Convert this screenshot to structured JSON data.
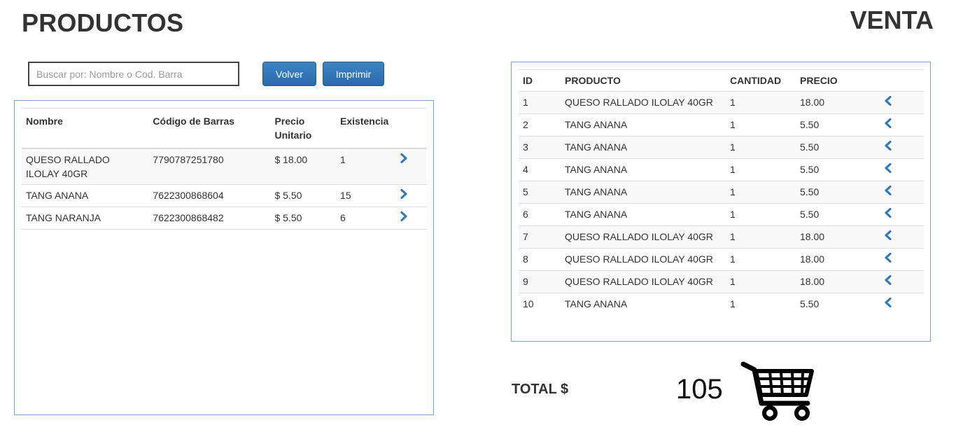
{
  "productos": {
    "title": "PRODUCTOS",
    "search": {
      "placeholder": "Buscar por: Nombre o Cod. Barra",
      "value": ""
    },
    "buttons": {
      "volver": "Volver",
      "imprimir": "Imprimir"
    },
    "columns": [
      "Nombre",
      "Código de Barras",
      "Precio Unitario",
      "Existencia"
    ],
    "rows": [
      {
        "nombre": "QUESO RALLADO ILOLAY 40GR",
        "codigo": "7790787251780",
        "precio": "$ 18.00",
        "existencia": "1"
      },
      {
        "nombre": "TANG ANANA",
        "codigo": "7622300868604",
        "precio": "$ 5.50",
        "existencia": "15"
      },
      {
        "nombre": "TANG NARANJA",
        "codigo": "7622300868482",
        "precio": "$ 5.50",
        "existencia": "6"
      }
    ],
    "row_action_icon": "chevron-right-icon"
  },
  "venta": {
    "title": "VENTA",
    "columns": [
      "ID",
      "PRODUCTO",
      "CANTIDAD",
      "PRECIO"
    ],
    "rows": [
      {
        "id": "1",
        "producto": "QUESO RALLADO ILOLAY 40GR",
        "cantidad": "1",
        "precio": "18.00"
      },
      {
        "id": "2",
        "producto": "TANG ANANA",
        "cantidad": "1",
        "precio": "5.50"
      },
      {
        "id": "3",
        "producto": "TANG ANANA",
        "cantidad": "1",
        "precio": "5.50"
      },
      {
        "id": "4",
        "producto": "TANG ANANA",
        "cantidad": "1",
        "precio": "5.50"
      },
      {
        "id": "5",
        "producto": "TANG ANANA",
        "cantidad": "1",
        "precio": "5.50"
      },
      {
        "id": "6",
        "producto": "TANG ANANA",
        "cantidad": "1",
        "precio": "5.50"
      },
      {
        "id": "7",
        "producto": "QUESO RALLADO ILOLAY 40GR",
        "cantidad": "1",
        "precio": "18.00"
      },
      {
        "id": "8",
        "producto": "QUESO RALLADO ILOLAY 40GR",
        "cantidad": "1",
        "precio": "18.00"
      },
      {
        "id": "9",
        "producto": "QUESO RALLADO ILOLAY 40GR",
        "cantidad": "1",
        "precio": "18.00"
      },
      {
        "id": "10",
        "producto": "TANG ANANA",
        "cantidad": "1",
        "precio": "5.50"
      }
    ],
    "row_action_icon": "chevron-left-icon",
    "total_label": "TOTAL $",
    "total_value": "105",
    "cart_icon": "shopping-cart-icon"
  },
  "colors": {
    "accent": "#337ab7",
    "panel_border": "#7b9fcf",
    "button": "#2a6aab",
    "text": "#333333"
  }
}
